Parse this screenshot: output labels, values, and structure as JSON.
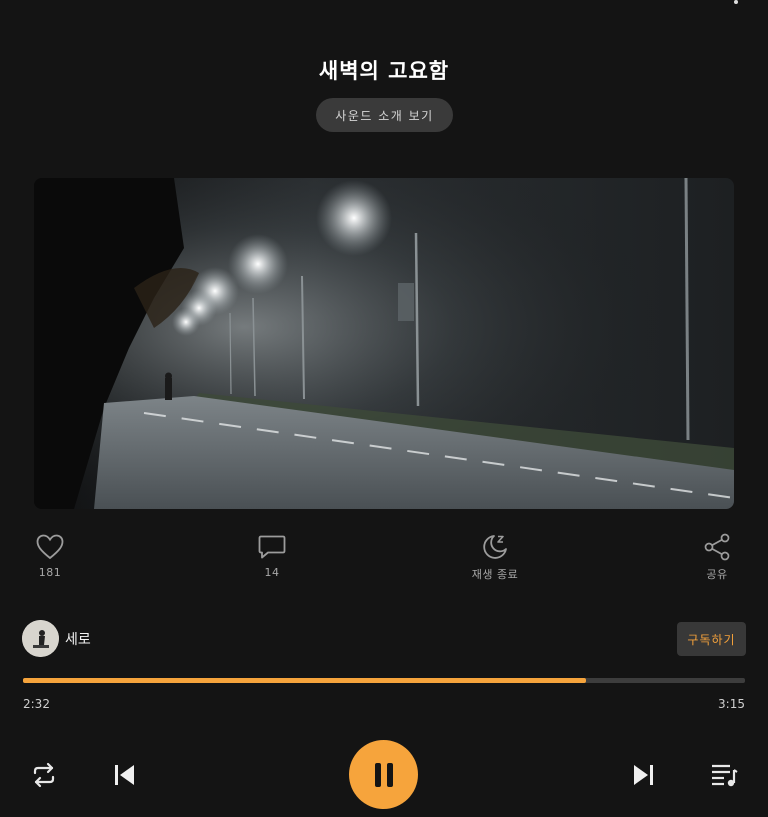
{
  "top_menu": {
    "icon": "more-vertical-icon"
  },
  "track": {
    "title": "새벽의 고요함"
  },
  "intro_button": {
    "label": "사운드 소개 보기"
  },
  "cover": {
    "alt": "foggy-night-road-streetlights"
  },
  "actions": {
    "like": {
      "icon": "heart-icon",
      "count": "181"
    },
    "comment": {
      "icon": "comment-icon",
      "count": "14"
    },
    "sleep": {
      "icon": "moon-sleep-icon",
      "label": "재생 종료"
    },
    "share": {
      "icon": "share-icon",
      "label": "공유"
    }
  },
  "artist": {
    "name": "세로",
    "subscribe_label": "구독하기"
  },
  "playback": {
    "current": "2:32",
    "total": "3:15",
    "progress": 0.78
  },
  "controls": {
    "repeat": "repeat-icon",
    "previous": "skip-previous-icon",
    "play_pause": "pause-icon",
    "next": "skip-next-icon",
    "playlist": "playlist-icon"
  },
  "colors": {
    "accent": "#f6a43c",
    "background": "#141414"
  }
}
